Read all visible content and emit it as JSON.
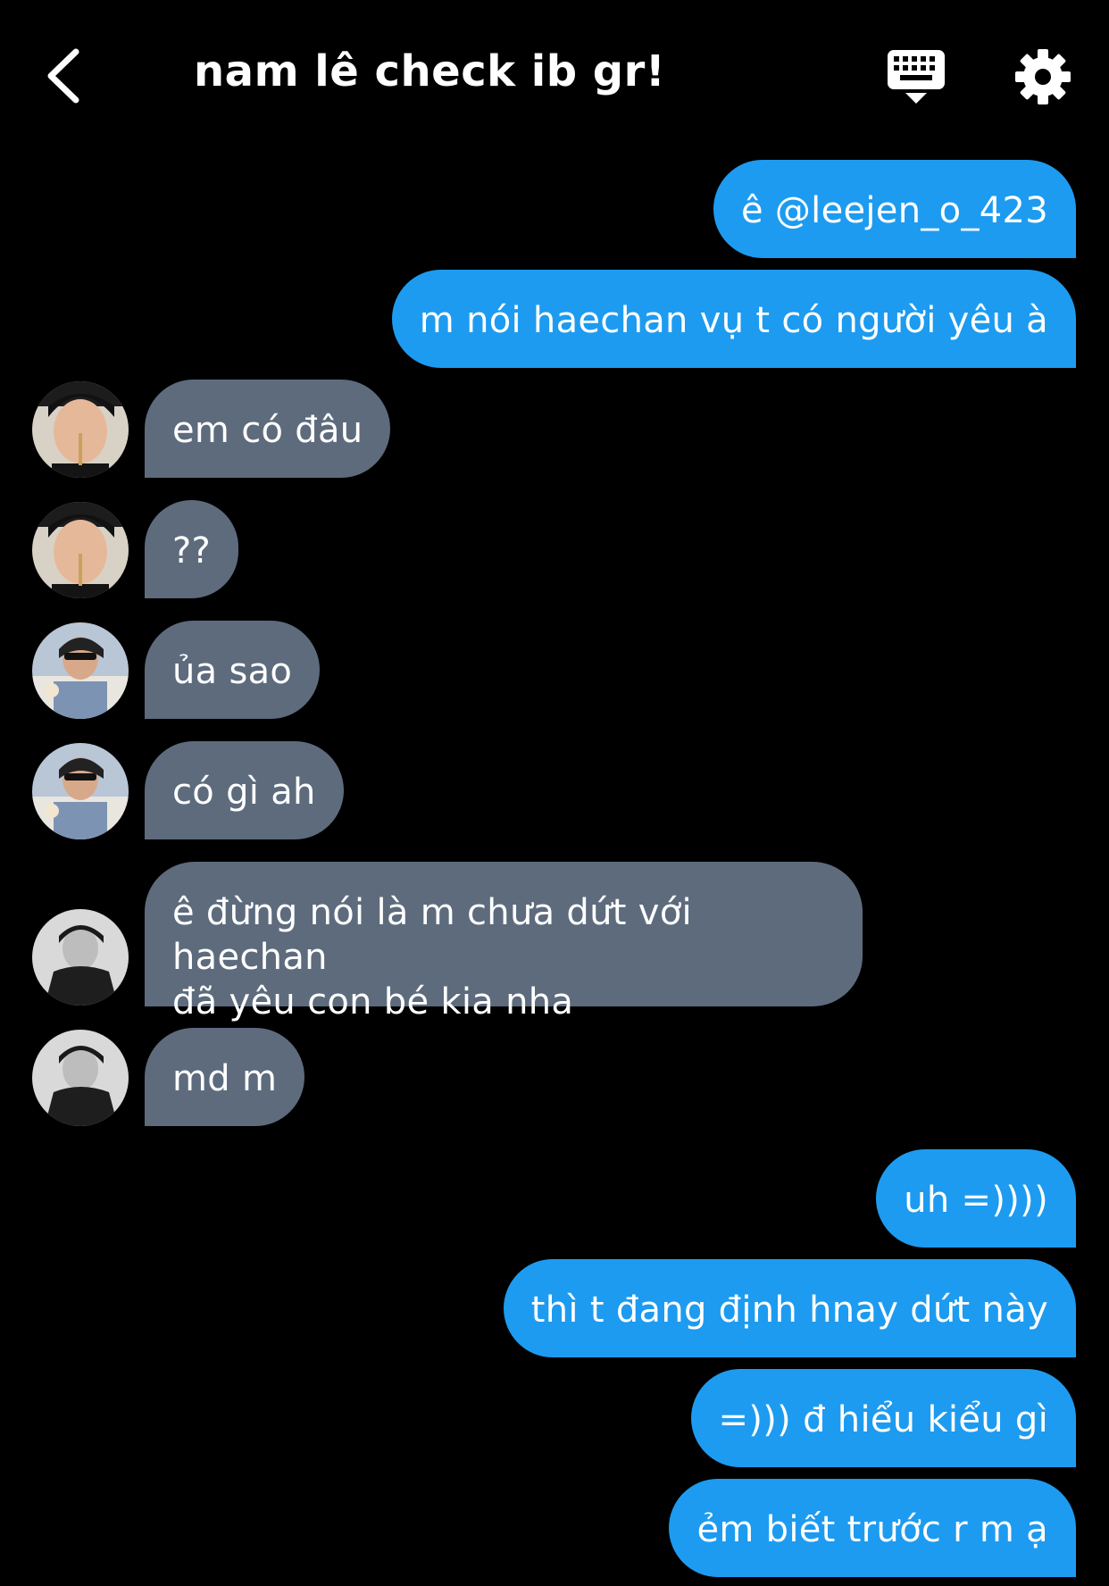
{
  "header": {
    "title": "nam lê check ib gr!",
    "back_icon": "chevron-left-icon",
    "keyboard_icon": "keyboard-icon",
    "settings_icon": "gear-icon"
  },
  "colors": {
    "background": "#000000",
    "outgoing_bubble": "#1d9bf0",
    "incoming_bubble": "#5d6b7d",
    "text": "#ffffff"
  },
  "messages": [
    {
      "dir": "out",
      "text": "ê @leejen_o_423"
    },
    {
      "dir": "out",
      "text": "m nói haechan vụ t có người yêu à"
    },
    {
      "dir": "in",
      "avatar": "user-a",
      "text": "em có đâu"
    },
    {
      "dir": "in",
      "avatar": "user-a",
      "text": "??"
    },
    {
      "dir": "in",
      "avatar": "user-b",
      "text": "ủa sao"
    },
    {
      "dir": "in",
      "avatar": "user-b",
      "text": "có gì ah"
    },
    {
      "dir": "in",
      "avatar": "user-c",
      "lines": [
        "ê đừng nói là m chưa dứt với haechan",
        "đã yêu con bé kia nha"
      ]
    },
    {
      "dir": "in",
      "avatar": "user-c",
      "text": "md m"
    },
    {
      "dir": "out",
      "text": "uh =))))"
    },
    {
      "dir": "out",
      "text": "thì t đang định hnay dứt này"
    },
    {
      "dir": "out",
      "text": "=))) đ hiểu kiểu gì"
    },
    {
      "dir": "out",
      "text": "ẻm biết trước r m ạ"
    }
  ]
}
